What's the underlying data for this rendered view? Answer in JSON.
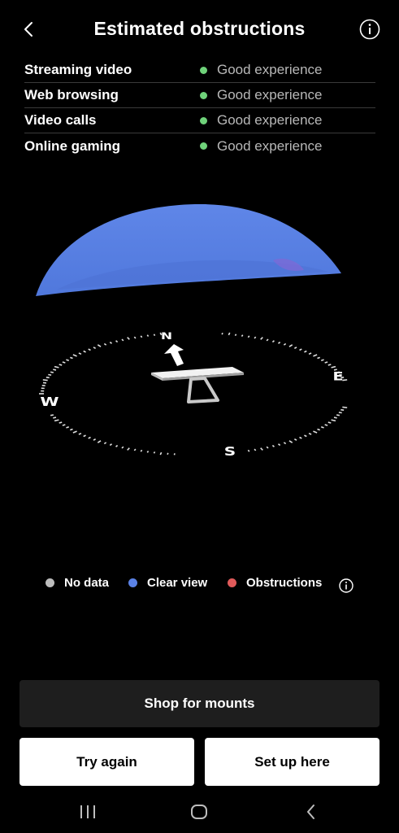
{
  "header": {
    "title": "Estimated obstructions",
    "back_icon": "chevron-left-icon",
    "info_icon": "info-icon"
  },
  "quality": [
    {
      "label": "Streaming video",
      "status": "Good experience",
      "status_color": "#6fd27a"
    },
    {
      "label": "Web browsing",
      "status": "Good experience",
      "status_color": "#6fd27a"
    },
    {
      "label": "Video calls",
      "status": "Good experience",
      "status_color": "#6fd27a"
    },
    {
      "label": "Online gaming",
      "status": "Good experience",
      "status_color": "#6fd27a"
    }
  ],
  "compass": {
    "north": "N",
    "east": "E",
    "south": "S",
    "west": "W"
  },
  "legend": [
    {
      "label": "No data",
      "color": "#bdbdbd"
    },
    {
      "label": "Clear view",
      "color": "#5b82e6"
    },
    {
      "label": "Obstructions",
      "color": "#e05a5a"
    }
  ],
  "buttons": {
    "shop": "Shop for mounts",
    "try_again": "Try again",
    "set_up": "Set up here"
  },
  "navbar": {
    "recents_icon": "recents-icon",
    "home_icon": "home-icon",
    "back_icon": "back-icon"
  }
}
